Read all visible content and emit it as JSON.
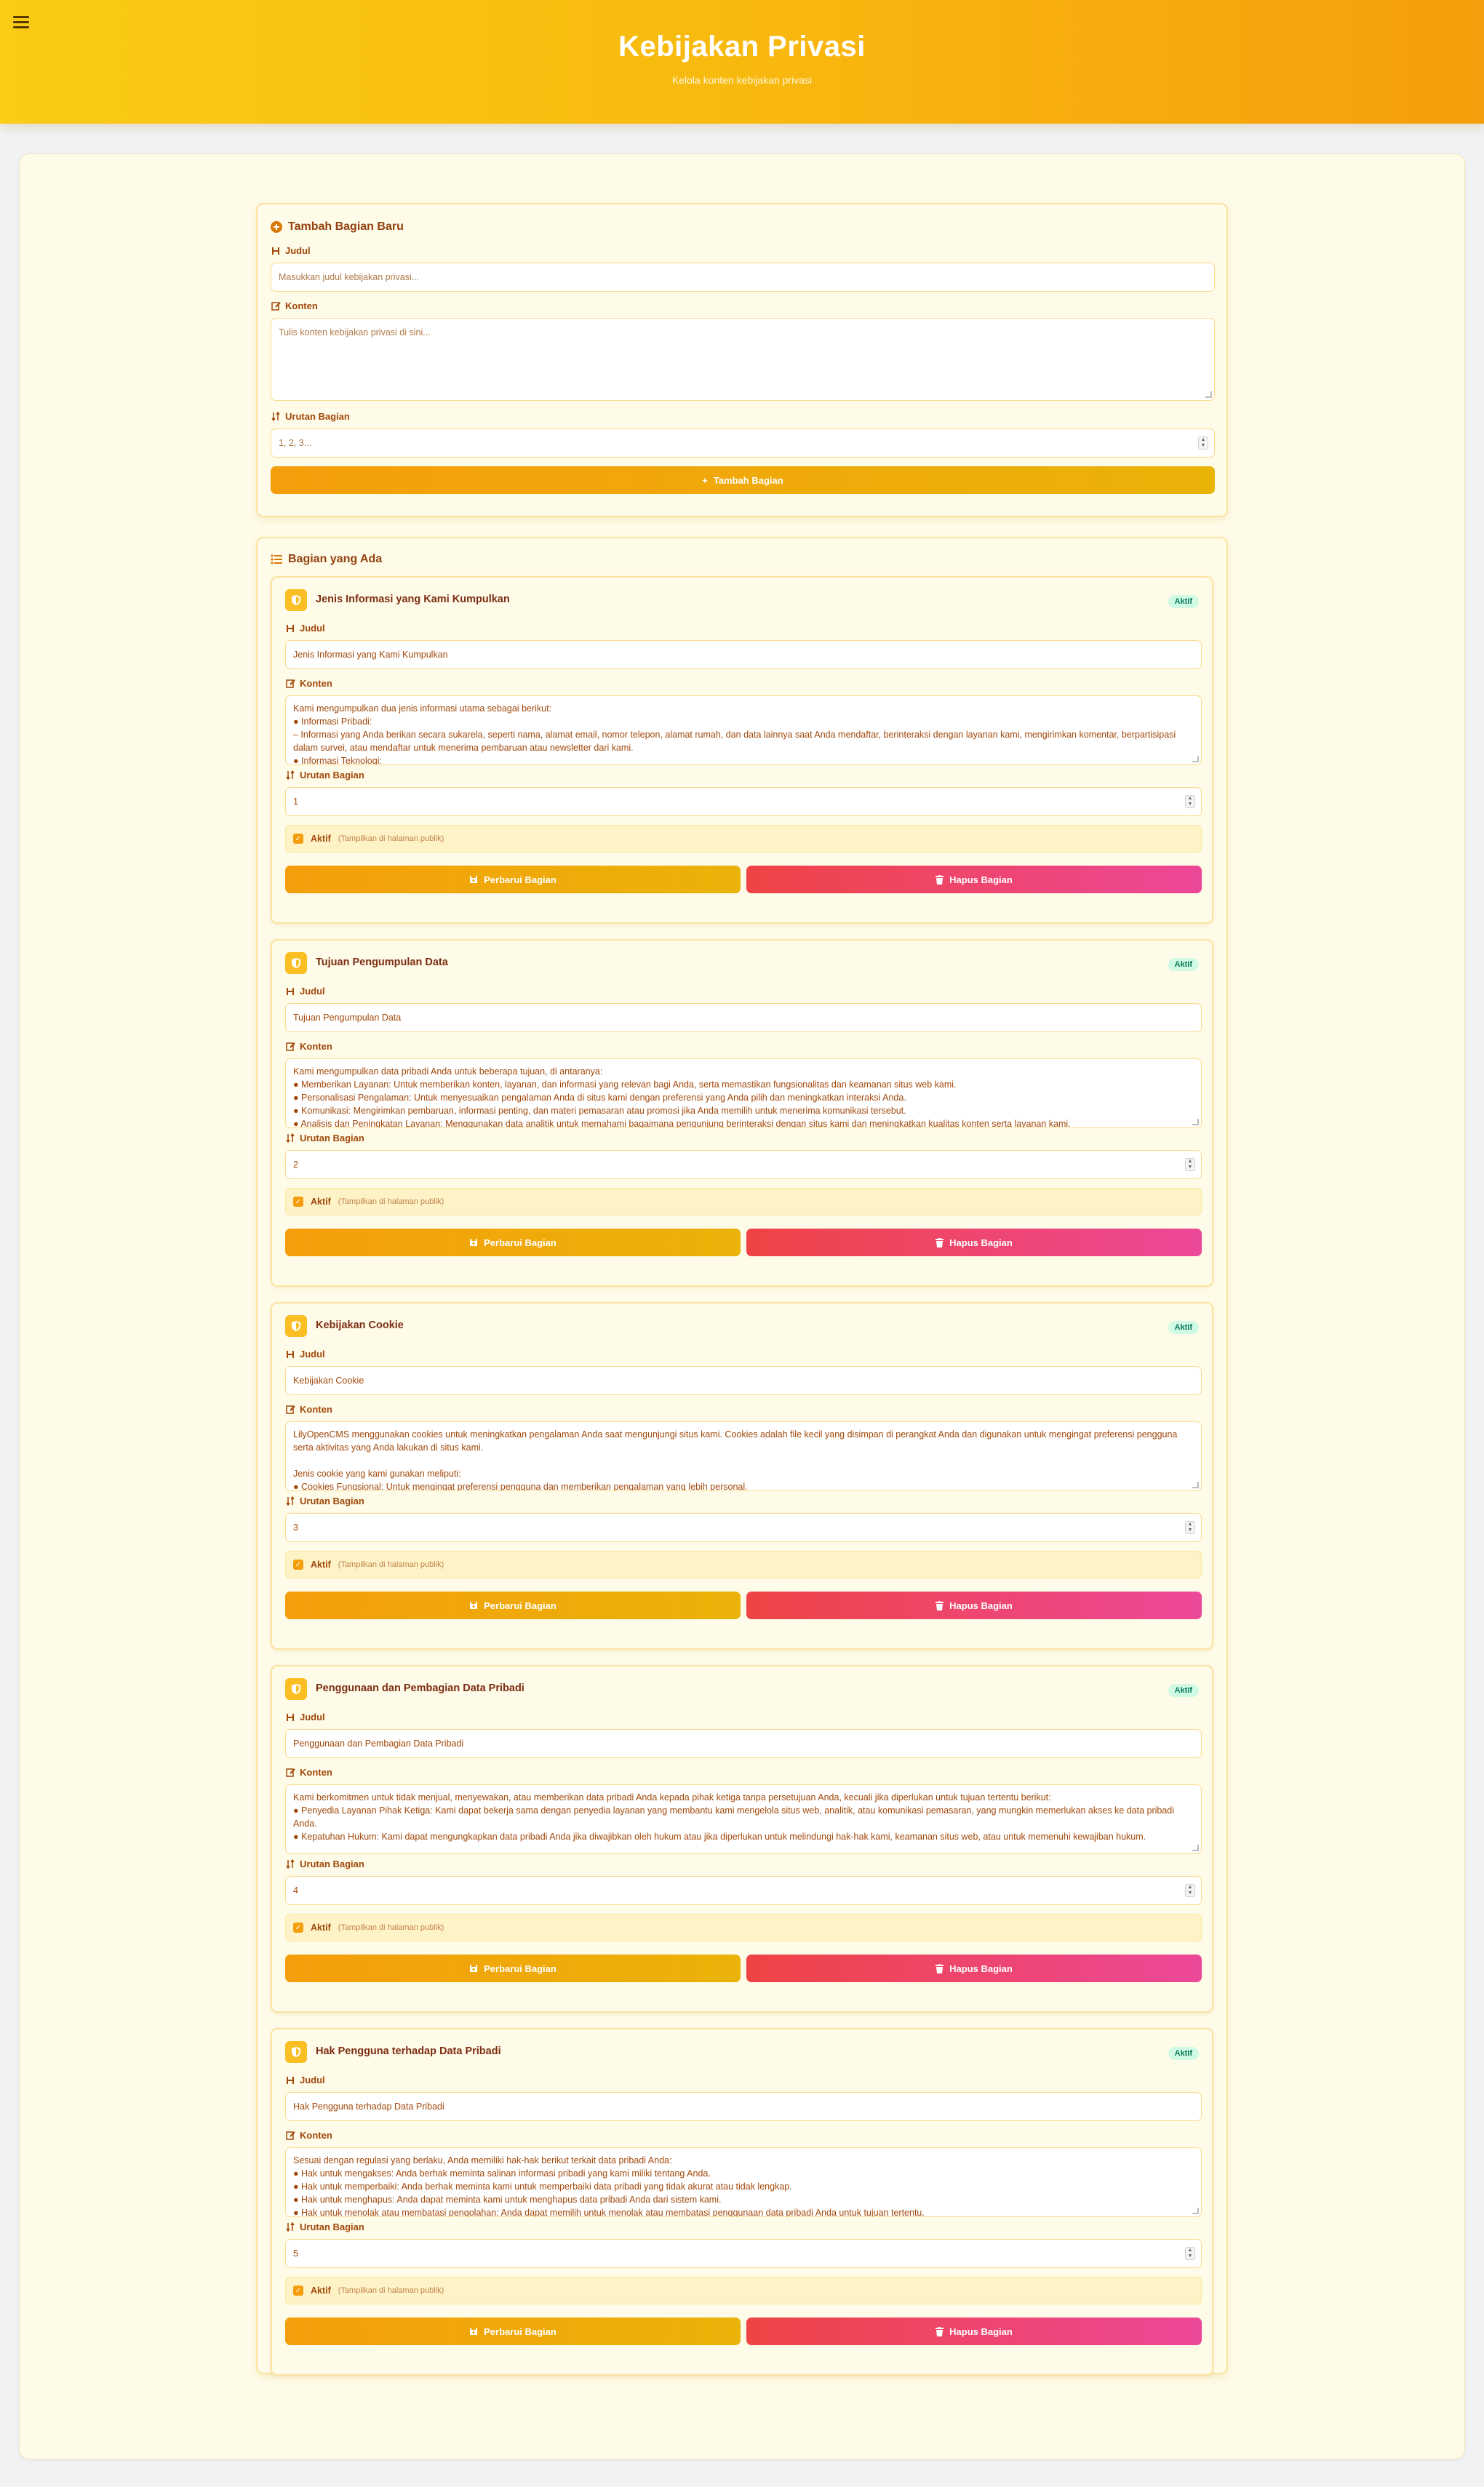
{
  "header": {
    "title": "Kebijakan Privasi",
    "subtitle": "Kelola konten kebijakan privasi"
  },
  "add_form": {
    "title": "Tambah Bagian Baru",
    "title_label": "Judul",
    "title_placeholder": "Masukkan judul kebijakan privasi...",
    "content_label": "Konten",
    "content_placeholder": "Tulis konten kebijakan privasi di sini...",
    "order_label": "Urutan Bagian",
    "order_placeholder": "1, 2, 3...",
    "submit_label": "Tambah Bagian"
  },
  "existing": {
    "title": "Bagian yang Ada",
    "labels": {
      "title": "Judul",
      "content": "Konten",
      "order": "Urutan Bagian",
      "active": "Aktif",
      "active_hint": "(Tampilkan di halaman publik)",
      "update": "Perbarui Bagian",
      "delete": "Hapus Bagian"
    },
    "sections": [
      {
        "heading": "Jenis Informasi yang Kami Kumpulkan",
        "badge": "Aktif",
        "title_value": "Jenis Informasi yang Kami Kumpulkan",
        "content": "Kami mengumpulkan dua jenis informasi utama sebagai berikut:\n● Informasi Pribadi:\n– Informasi yang Anda berikan secara sukarela, seperti nama, alamat email, nomor telepon, alamat rumah, dan data lainnya saat Anda mendaftar, berinteraksi dengan layanan kami, mengirimkan komentar, berpartisipasi\ndalam survei, atau mendaftar untuk menerima pembaruan atau newsletter dari kami.\n● Informasi Teknologi:",
        "order": "1",
        "active": true
      },
      {
        "heading": "Tujuan Pengumpulan Data",
        "badge": "Aktif",
        "title_value": "Tujuan Pengumpulan Data",
        "content": "Kami mengumpulkan data pribadi Anda untuk beberapa tujuan, di antaranya:\n● Memberikan Layanan: Untuk memberikan konten, layanan, dan informasi yang relevan bagi Anda, serta memastikan fungsionalitas dan keamanan situs web kami.\n● Personalisasi Pengalaman: Untuk menyesuaikan pengalaman Anda di situs kami dengan preferensi yang Anda pilih dan meningkatkan interaksi Anda.\n● Komunikasi: Mengirimkan pembaruan, informasi penting, dan materi pemasaran atau promosi jika Anda memilih untuk menerima komunikasi tersebut.\n● Analisis dan Peningkatan Layanan: Menggunakan data analitik untuk memahami bagaimana pengunjung berinteraksi dengan situs kami dan meningkatkan kualitas konten serta layanan kami.",
        "order": "2",
        "active": true
      },
      {
        "heading": "Kebijakan Cookie",
        "badge": "Aktif",
        "title_value": "Kebijakan Cookie",
        "content": "LilyOpenCMS menggunakan cookies untuk meningkatkan pengalaman Anda saat mengunjungi situs kami. Cookies adalah file kecil yang disimpan di perangkat Anda dan digunakan untuk mengingat preferensi pengguna\nserta aktivitas yang Anda lakukan di situs kami.\n\nJenis cookie yang kami gunakan meliputi:\n● Cookies Fungsional: Untuk mengingat preferensi pengguna dan memberikan pengalaman yang lebih personal.",
        "order": "3",
        "active": true
      },
      {
        "heading": "Penggunaan dan Pembagian Data Pribadi",
        "badge": "Aktif",
        "title_value": "Penggunaan dan Pembagian Data Pribadi",
        "content": "Kami berkomitmen untuk tidak menjual, menyewakan, atau memberikan data pribadi Anda kepada pihak ketiga tanpa persetujuan Anda, kecuali jika diperlukan untuk tujuan tertentu berikut:\n● Penyedia Layanan Pihak Ketiga: Kami dapat bekerja sama dengan penyedia layanan yang membantu kami mengelola situs web, analitik, atau komunikasi pemasaran, yang mungkin memerlukan akses ke data pribadi Anda.\n● Kepatuhan Hukum: Kami dapat mengungkapkan data pribadi Anda jika diwajibkan oleh hukum atau jika diperlukan untuk melindungi hak-hak kami, keamanan situs web, atau untuk memenuhi kewajiban hukum.",
        "order": "4",
        "active": true
      },
      {
        "heading": "Hak Pengguna terhadap Data Pribadi",
        "badge": "Aktif",
        "title_value": "Hak Pengguna terhadap Data Pribadi",
        "content": "Sesuai dengan regulasi yang berlaku, Anda memiliki hak-hak berikut terkait data pribadi Anda:\n● Hak untuk mengakses: Anda berhak meminta salinan informasi pribadi yang kami miliki tentang Anda.\n● Hak untuk memperbaiki: Anda berhak meminta kami untuk memperbaiki data pribadi yang tidak akurat atau tidak lengkap.\n● Hak untuk menghapus: Anda dapat meminta kami untuk menghapus data pribadi Anda dari sistem kami.\n● Hak untuk menolak atau membatasi pengolahan: Anda dapat memilih untuk menolak atau membatasi penggunaan data pribadi Anda untuk tujuan tertentu.",
        "order": "5",
        "active": true
      }
    ]
  }
}
